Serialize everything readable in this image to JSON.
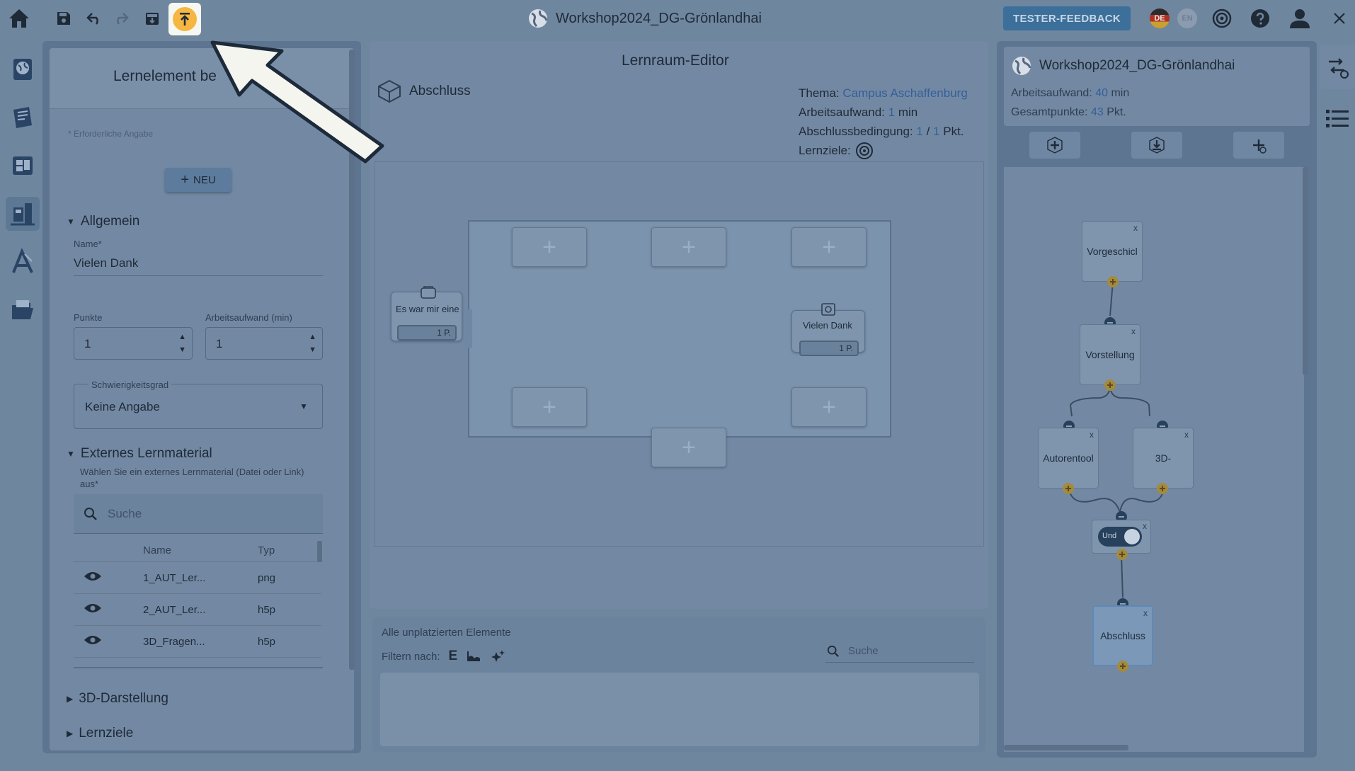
{
  "topbar": {
    "title": "Workshop2024_DG-Grönlandhai",
    "feedback_label": "TESTER-FEEDBACK",
    "lang_de": "DE",
    "lang_en": "EN"
  },
  "left_panel": {
    "title": "Lernelement be",
    "required_note": "* Erforderliche Angabe",
    "new_label": "NEU",
    "general_section": "Allgemein",
    "name_label": "Name*",
    "name_value": "Vielen Dank",
    "points_label": "Punkte",
    "points_value": "1",
    "effort_label": "Arbeitsaufwand (min)",
    "effort_value": "1",
    "difficulty_label": "Schwierigkeitsgrad",
    "difficulty_value": "Keine Angabe",
    "external_section": "Externes Lernmaterial",
    "external_hint": "Wählen Sie ein externes Lernmaterial (Datei oder Link) aus*",
    "search_placeholder": "Suche",
    "table_headers": {
      "name": "Name",
      "type": "Typ"
    },
    "table_rows": [
      {
        "name": "1_AUT_Ler...",
        "type": "png"
      },
      {
        "name": "2_AUT_Ler...",
        "type": "h5p"
      },
      {
        "name": "3D_Fragen...",
        "type": "h5p"
      }
    ],
    "section_3d": "3D-Darstellung",
    "section_goals": "Lernziele"
  },
  "center": {
    "title": "Lernraum-Editor",
    "space_name": "Abschluss",
    "theme_label": "Thema:",
    "theme_value": "Campus Aschaffenburg",
    "effort_label": "Arbeitsaufwand:",
    "effort_value": "1",
    "effort_unit": "min",
    "condition_label": "Abschlussbedingung:",
    "condition_value": "1",
    "condition_sep": "/",
    "condition_total": "1",
    "condition_unit": "Pkt.",
    "goals_label": "Lernziele:",
    "element_left_name": "Es war mir eine",
    "element_left_points": "1 P.",
    "element_right_name": "Vielen Dank",
    "element_right_points": "1 P."
  },
  "unplaced": {
    "title": "Alle unplatzierten Elemente",
    "filter_label": "Filtern nach:",
    "search_placeholder": "Suche"
  },
  "right_panel": {
    "title": "Workshop2024_DG-Grönlandhai",
    "effort_label": "Arbeitsaufwand:",
    "effort_value": "40",
    "effort_unit": "min",
    "points_label": "Gesamtpunkte:",
    "points_value": "43",
    "points_unit": "Pkt.",
    "nodes": {
      "n1": "Vorgeschicl",
      "n2": "Vorstellung",
      "n3": "Autorentool",
      "n4": "3D-",
      "gate": "Und",
      "n5": "Abschluss"
    },
    "close_mark": "x"
  },
  "colors": {
    "accent": "#3c6f99",
    "highlight": "#f5b642",
    "link": "#355f9a"
  }
}
